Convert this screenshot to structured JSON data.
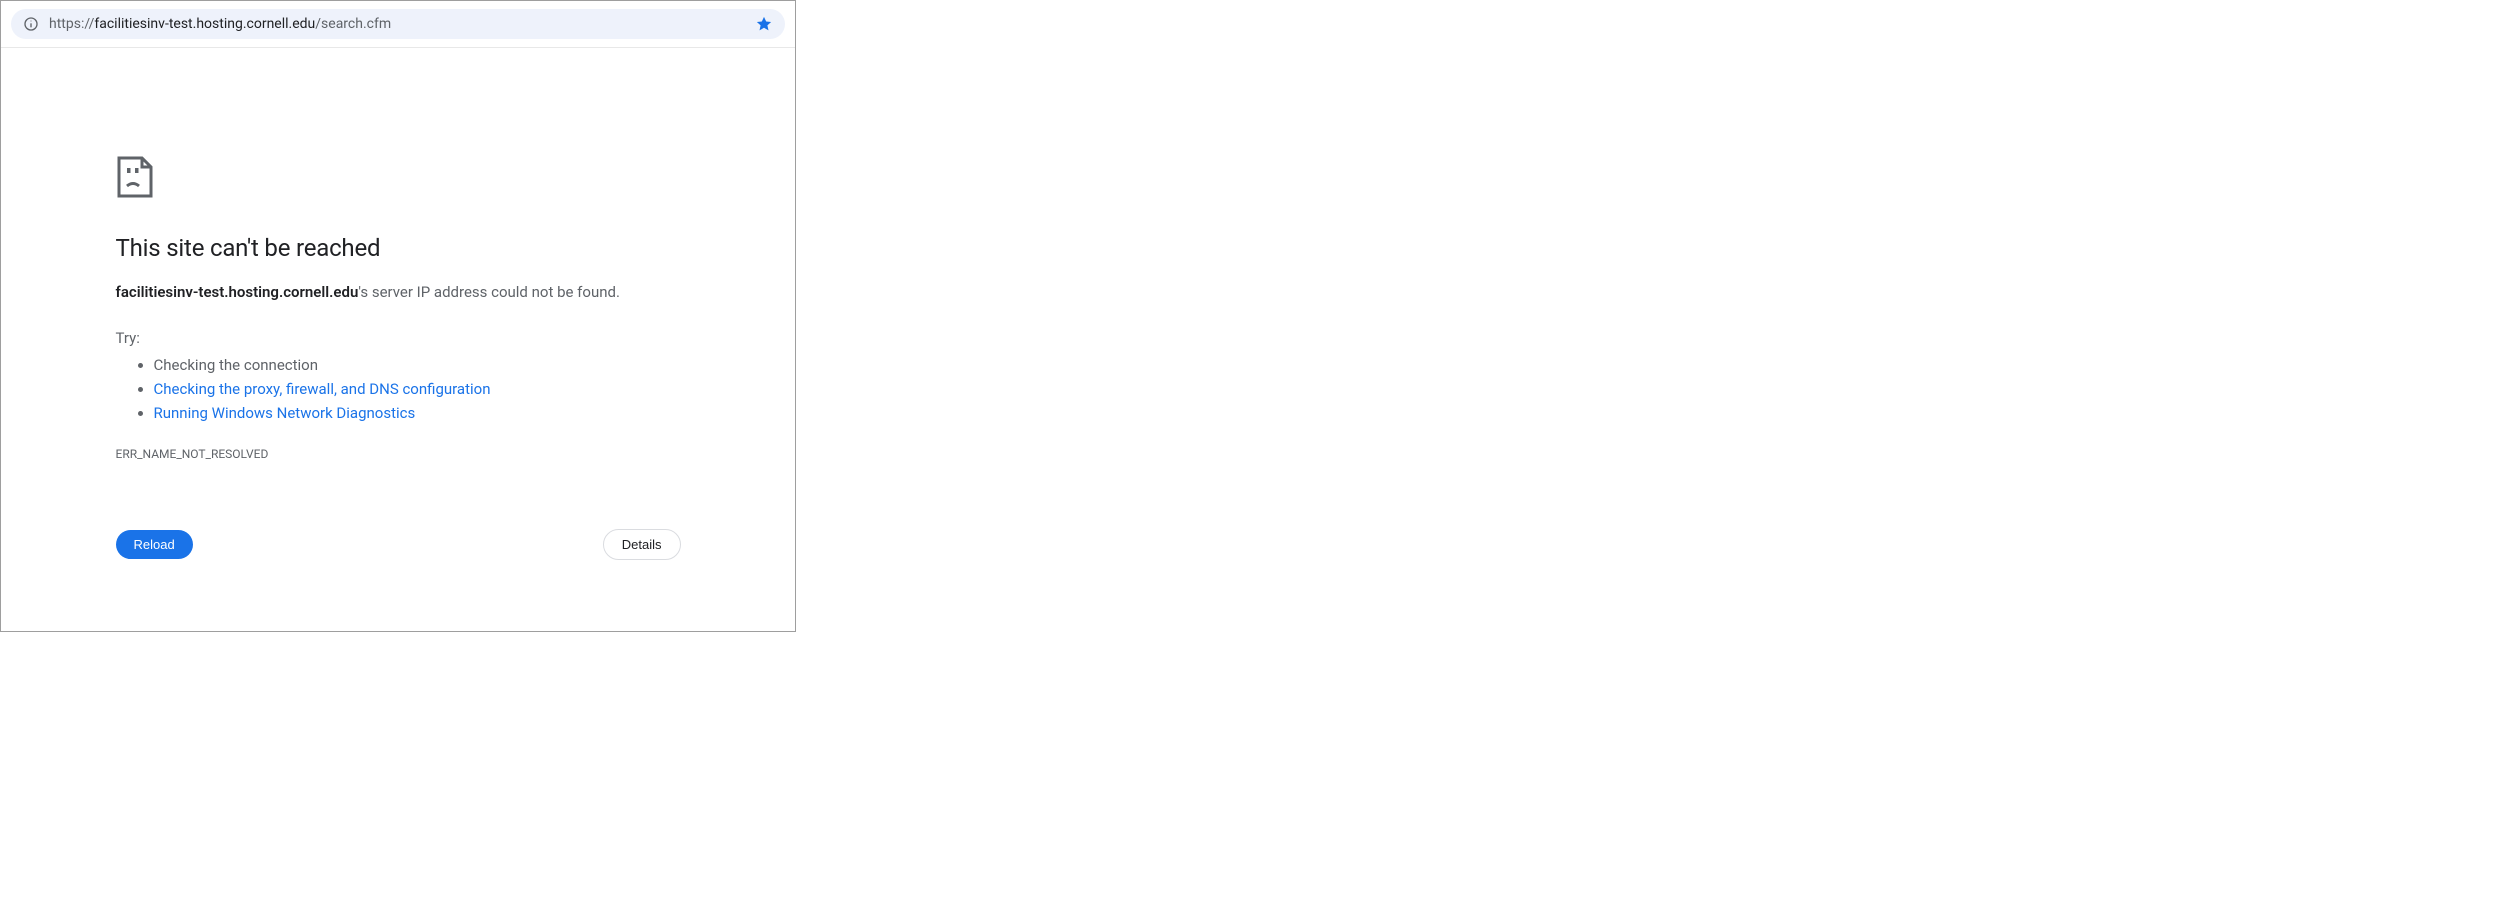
{
  "address_bar": {
    "url_prefix": "https://",
    "url_host": "facilitiesinv-test.hosting.cornell.edu",
    "url_path": "/search.cfm"
  },
  "error": {
    "heading": "This site can't be reached",
    "host_bold": "facilitiesinv-test.hosting.cornell.edu",
    "host_suffix": "'s server IP address could not be found.",
    "try_label": "Try:",
    "suggestions": {
      "plain": "Checking the connection",
      "link1": "Checking the proxy, firewall, and DNS configuration",
      "link2": "Running Windows Network Diagnostics"
    },
    "code": "ERR_NAME_NOT_RESOLVED"
  },
  "buttons": {
    "reload": "Reload",
    "details": "Details"
  }
}
